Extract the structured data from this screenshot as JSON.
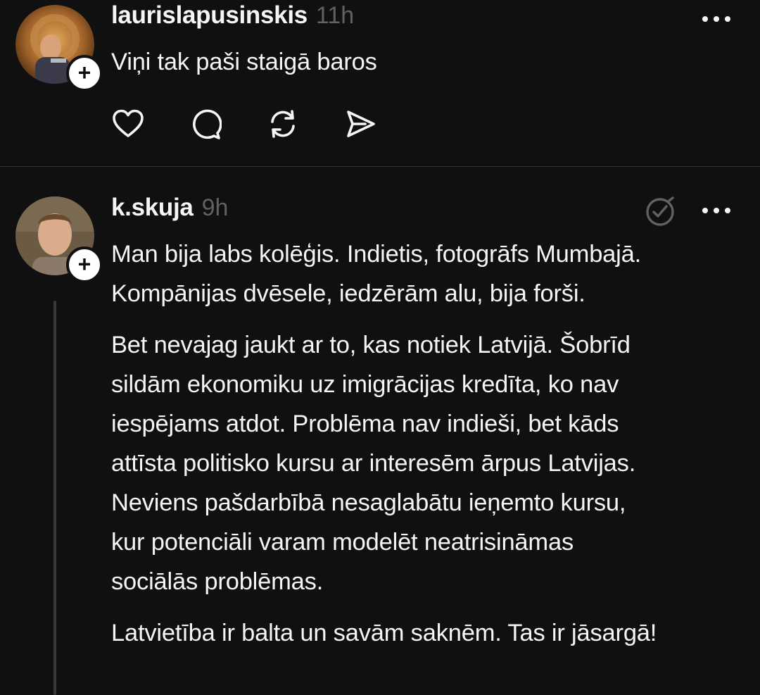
{
  "posts": [
    {
      "username": "laurislapusinskis",
      "time": "11h",
      "paragraphs": [
        "Viņi tak paši staigā baros"
      ],
      "follow_symbol": "+",
      "actions": [
        "heart-icon",
        "comment-icon",
        "repost-icon",
        "share-icon"
      ]
    },
    {
      "username": "k.skuja",
      "time": "9h",
      "paragraphs": [
        [
          "Man bija labs kolēģis. Indietis, fotogrāfs Mumbajā.",
          "Kompānijas dvēsele, iedzērām alu, bija forši."
        ],
        [
          "Bet nevajag jaukt ar to, kas notiek Latvijā. Šobrīd",
          "sildām ekonomiku uz imigrācijas kredīta, ko nav",
          "iespējams atdot. Problēma nav indieši, bet kāds",
          "attīsta politisko kursu ar interesēm ārpus Latvijas.",
          "Neviens pašdarbībā nesaglabātu ieņemto kursu,",
          "kur potenciāli varam modelēt neatrisināmas",
          "sociālās problēmas."
        ],
        [
          "Latvietība ir balta un savām saknēm. Tas ir jāsargā!"
        ]
      ],
      "follow_symbol": "+"
    }
  ],
  "colors": {
    "background": "#101010",
    "text": "#f3f5f7",
    "muted": "#616161",
    "icon": "#f3f5f7"
  }
}
